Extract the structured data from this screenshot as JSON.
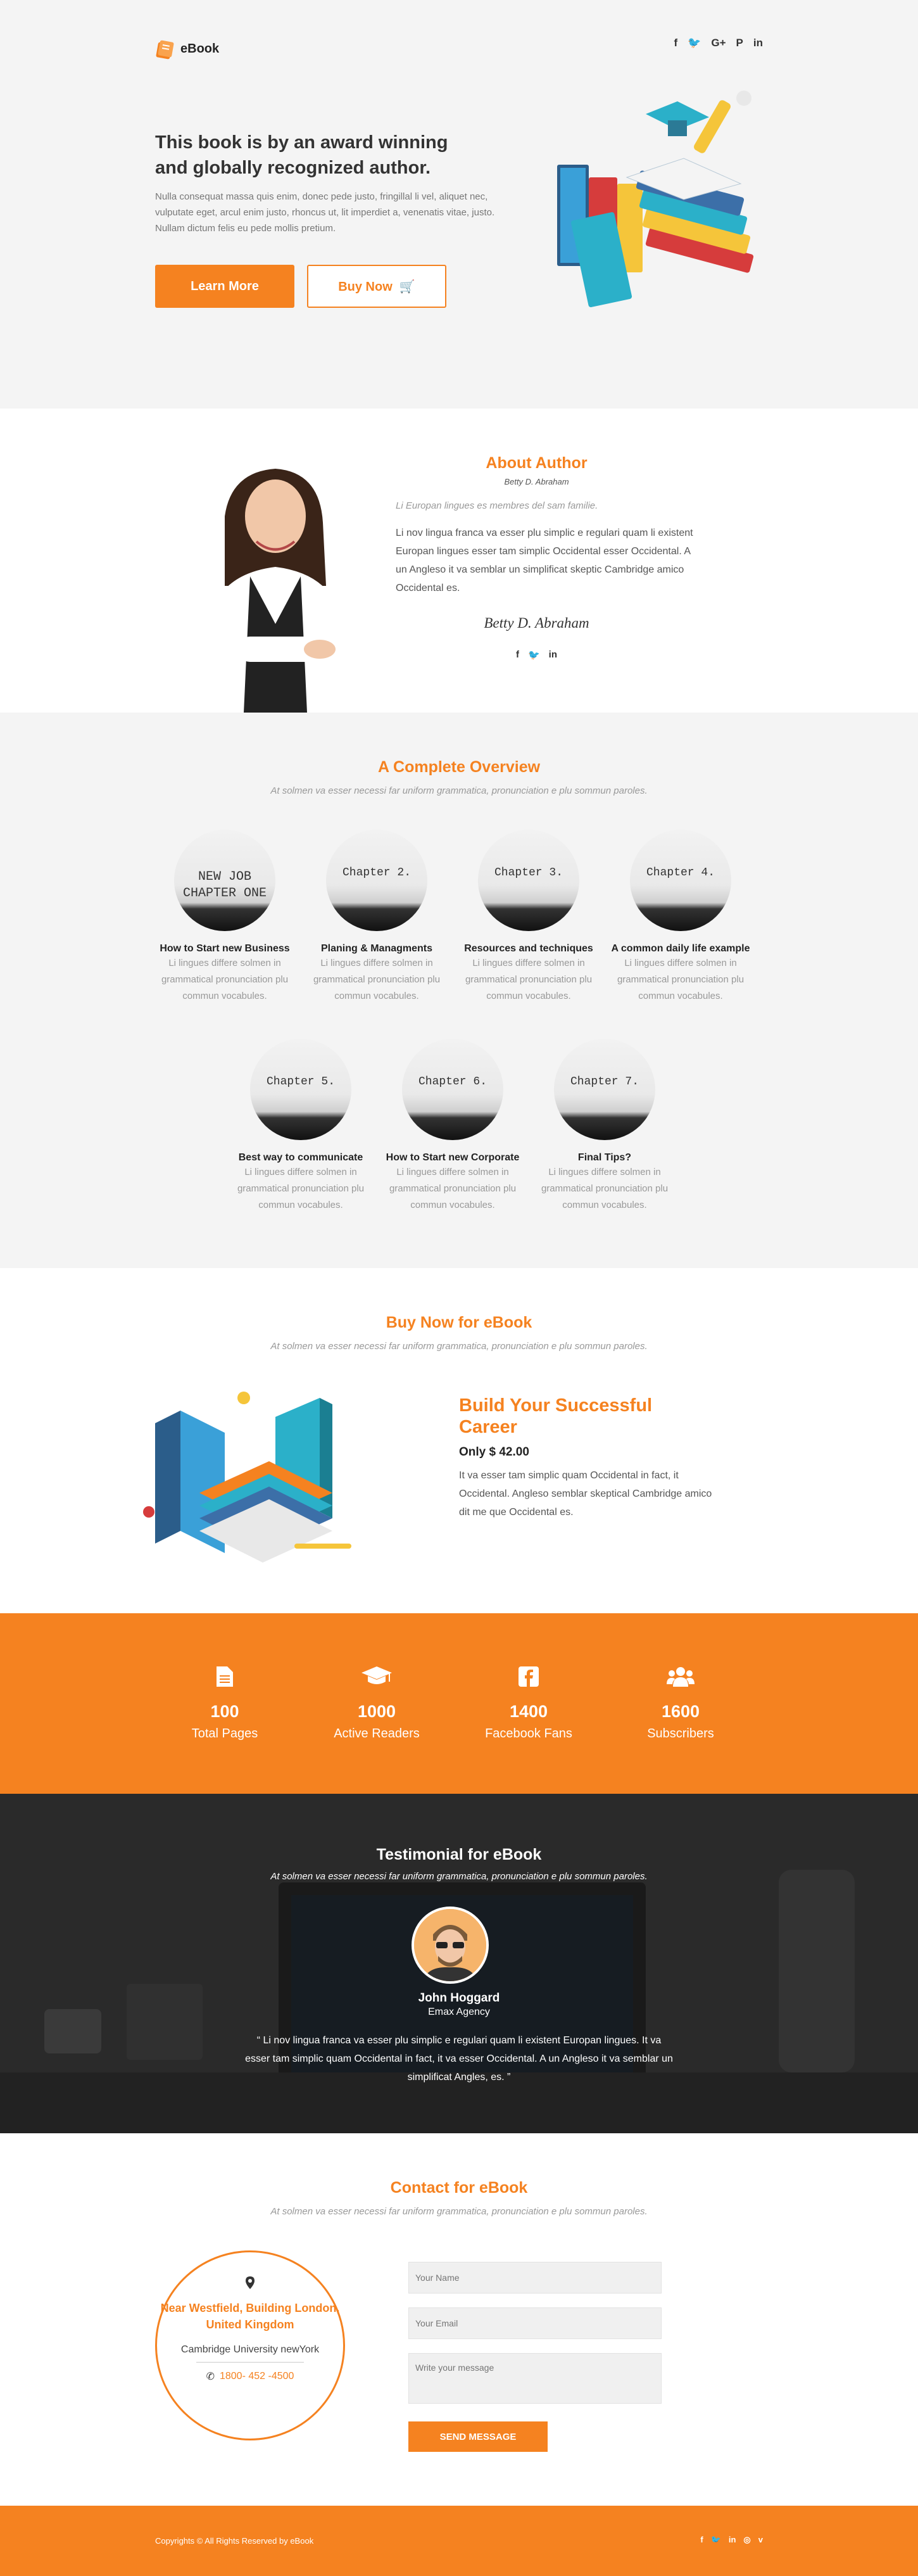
{
  "brand": {
    "name": "eBook",
    "accent": "#f58220"
  },
  "header": {
    "social": [
      "f",
      "🐦",
      "G+",
      "P",
      "in"
    ]
  },
  "hero": {
    "title": "This book is by an award winning and globally recognized author.",
    "text": "Nulla consequat massa quis enim, donec pede justo, fringillal li vel, aliquet nec, vulputate eget, arcul enim justo, rhoncus ut, lit imperdiet a, venenatis vitae, justo. Nullam dictum felis eu pede mollis pretium.",
    "learn_label": "Learn More",
    "buy_label": "Buy Now"
  },
  "about": {
    "title": "About Author",
    "name": "Betty D. Abraham",
    "quote": "Li Europan lingues es membres del sam familie.",
    "text": "Li nov lingua franca va esser plu simplic e regulari quam li existent Europan lingues esser tam simplic Occidental esser Occidental. A un Angleso it va semblar un simplificat skeptic Cambridge amico Occidental es.",
    "signature": "Betty D. Abraham",
    "social": [
      "f",
      "🐦",
      "in"
    ]
  },
  "overview": {
    "title": "A Complete Overview",
    "subtitle": "At solmen va esser necessi far uniform grammatica, pronunciation e plu sommun paroles.",
    "chapters": [
      {
        "img_text": "NEW JOB\nCHAPTER ONE",
        "title": "How to Start new Business",
        "text": "Li lingues differe solmen in grammatical  pronunciation plu commun vocabules."
      },
      {
        "img_text": "Chapter 2.",
        "title": "Planing & Managments",
        "text": "Li lingues differe solmen in grammatical  pronunciation plu commun vocabules."
      },
      {
        "img_text": "Chapter 3.",
        "title": "Resources and techniques",
        "text": "Li lingues differe solmen in grammatical  pronunciation plu commun vocabules."
      },
      {
        "img_text": "Chapter 4.",
        "title": "A common daily life example",
        "text": "Li lingues differe solmen in grammatical  pronunciation plu commun vocabules."
      },
      {
        "img_text": "Chapter 5.",
        "title": "Best way to communicate",
        "text": "Li lingues differe solmen in grammatical  pronunciation plu commun vocabules."
      },
      {
        "img_text": "Chapter 6.",
        "title": "How to Start new Corporate",
        "text": "Li lingues differe solmen in grammatical  pronunciation plu commun vocabules."
      },
      {
        "img_text": "Chapter 7.",
        "title": "Final Tips?",
        "text": "Li lingues differe solmen in grammatical  pronunciation plu commun vocabules."
      }
    ]
  },
  "buy": {
    "title": "Buy Now for eBook",
    "subtitle": "At solmen va esser necessi far uniform grammatica, pronunciation e plu sommun paroles.",
    "heading": "Build Your Successful Career",
    "price": "Only $ 42.00",
    "text": "It va esser tam simplic quam Occidental in fact, it Occidental. Angleso  semblar skeptical Cambridge amico dit me que Occidental es."
  },
  "stats": [
    {
      "icon": "document-icon",
      "num": "100",
      "label": "Total Pages"
    },
    {
      "icon": "graduation-cap-icon",
      "num": "1000",
      "label": "Active Readers"
    },
    {
      "icon": "facebook-icon",
      "num": "1400",
      "label": "Facebook Fans"
    },
    {
      "icon": "users-icon",
      "num": "1600",
      "label": "Subscribers"
    }
  ],
  "testimonial": {
    "title": "Testimonial for eBook",
    "subtitle": "At solmen va esser necessi far uniform grammatica, pronunciation e plu sommun paroles.",
    "name": "John Hoggard",
    "role": "Emax Agency",
    "text": "“ Li nov lingua franca va esser plu simplic e regulari quam li existent Europan lingues. It va esser tam simplic quam Occidental in fact, it va esser Occidental. A un Angleso it va semblar un simplificat Angles, es. ”"
  },
  "contact": {
    "title": "Contact for eBook",
    "subtitle": "At solmen va esser necessi far uniform grammatica, pronunciation e plu sommun paroles.",
    "address": "Near Westfield, Building London, United Kingdom",
    "uni": "Cambridge University newYork",
    "phone": "1800- 452 -4500",
    "name_ph": "Your Name",
    "email_ph": "Your Email",
    "msg_ph": "Write your message",
    "send_label": "SEND MESSAGE"
  },
  "footer": {
    "copyright": "Copyrights © All Rights Reserved by eBook",
    "social": [
      "f",
      "🐦",
      "in",
      "◎",
      "v"
    ]
  }
}
